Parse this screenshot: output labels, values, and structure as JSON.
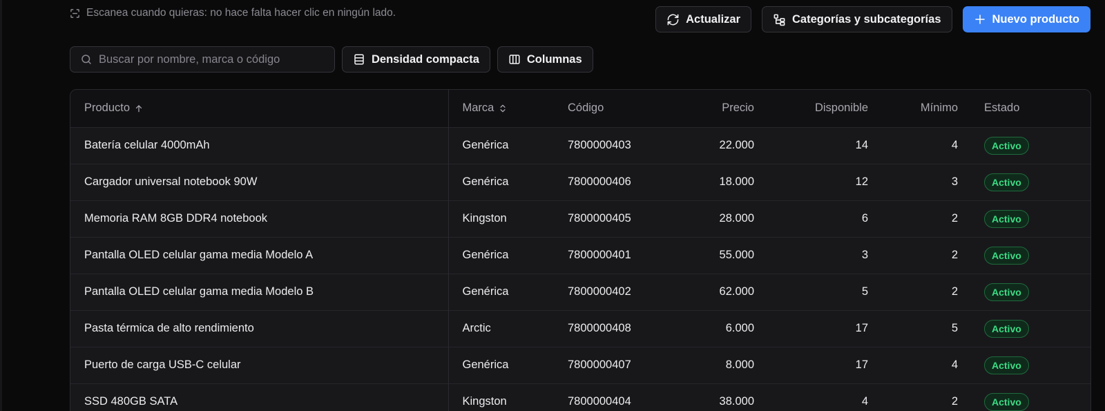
{
  "hint": {
    "text": "Escanea cuando quieras: no hace falta hacer clic en ningún lado.",
    "icon": "scan-icon"
  },
  "actions": {
    "refresh": {
      "label": "Actualizar",
      "icon": "refresh-icon"
    },
    "categories": {
      "label": "Categorías y subcategorías",
      "icon": "category-tree-icon"
    },
    "new_product": {
      "label": "Nuevo producto",
      "icon": "plus-icon"
    }
  },
  "toolbar": {
    "search": {
      "placeholder": "Buscar por nombre, marca o código",
      "value": "",
      "icon": "search-icon"
    },
    "density": {
      "label": "Densidad compacta",
      "icon": "rows-icon"
    },
    "columns": {
      "label": "Columnas",
      "icon": "columns-icon"
    }
  },
  "table": {
    "headers": {
      "producto": "Producto",
      "marca": "Marca",
      "codigo": "Código",
      "precio": "Precio",
      "disponible": "Disponible",
      "minimo": "Mínimo",
      "estado": "Estado"
    },
    "sort": {
      "producto": "ascending",
      "marca": "sortable"
    },
    "rows": [
      {
        "producto": "Batería celular 4000mAh",
        "marca": "Genérica",
        "codigo": "7800000403",
        "precio": "22.000",
        "disponible": "14",
        "minimo": "4",
        "estado": "Activo"
      },
      {
        "producto": "Cargador universal notebook 90W",
        "marca": "Genérica",
        "codigo": "7800000406",
        "precio": "18.000",
        "disponible": "12",
        "minimo": "3",
        "estado": "Activo"
      },
      {
        "producto": "Memoria RAM 8GB DDR4 notebook",
        "marca": "Kingston",
        "codigo": "7800000405",
        "precio": "28.000",
        "disponible": "6",
        "minimo": "2",
        "estado": "Activo"
      },
      {
        "producto": "Pantalla OLED celular gama media Modelo A",
        "marca": "Genérica",
        "codigo": "7800000401",
        "precio": "55.000",
        "disponible": "3",
        "minimo": "2",
        "estado": "Activo"
      },
      {
        "producto": "Pantalla OLED celular gama media Modelo B",
        "marca": "Genérica",
        "codigo": "7800000402",
        "precio": "62.000",
        "disponible": "5",
        "minimo": "2",
        "estado": "Activo"
      },
      {
        "producto": "Pasta térmica de alto rendimiento",
        "marca": "Arctic",
        "codigo": "7800000408",
        "precio": "6.000",
        "disponible": "17",
        "minimo": "5",
        "estado": "Activo"
      },
      {
        "producto": "Puerto de carga USB-C celular",
        "marca": "Genérica",
        "codigo": "7800000407",
        "precio": "8.000",
        "disponible": "17",
        "minimo": "4",
        "estado": "Activo"
      },
      {
        "producto": "SSD 480GB SATA",
        "marca": "Kingston",
        "codigo": "7800000404",
        "precio": "38.000",
        "disponible": "4",
        "minimo": "2",
        "estado": "Activo"
      }
    ]
  },
  "colors": {
    "background": "#0a0a0b",
    "primary": "#3b82f6",
    "status_active": "#3ddc84"
  }
}
